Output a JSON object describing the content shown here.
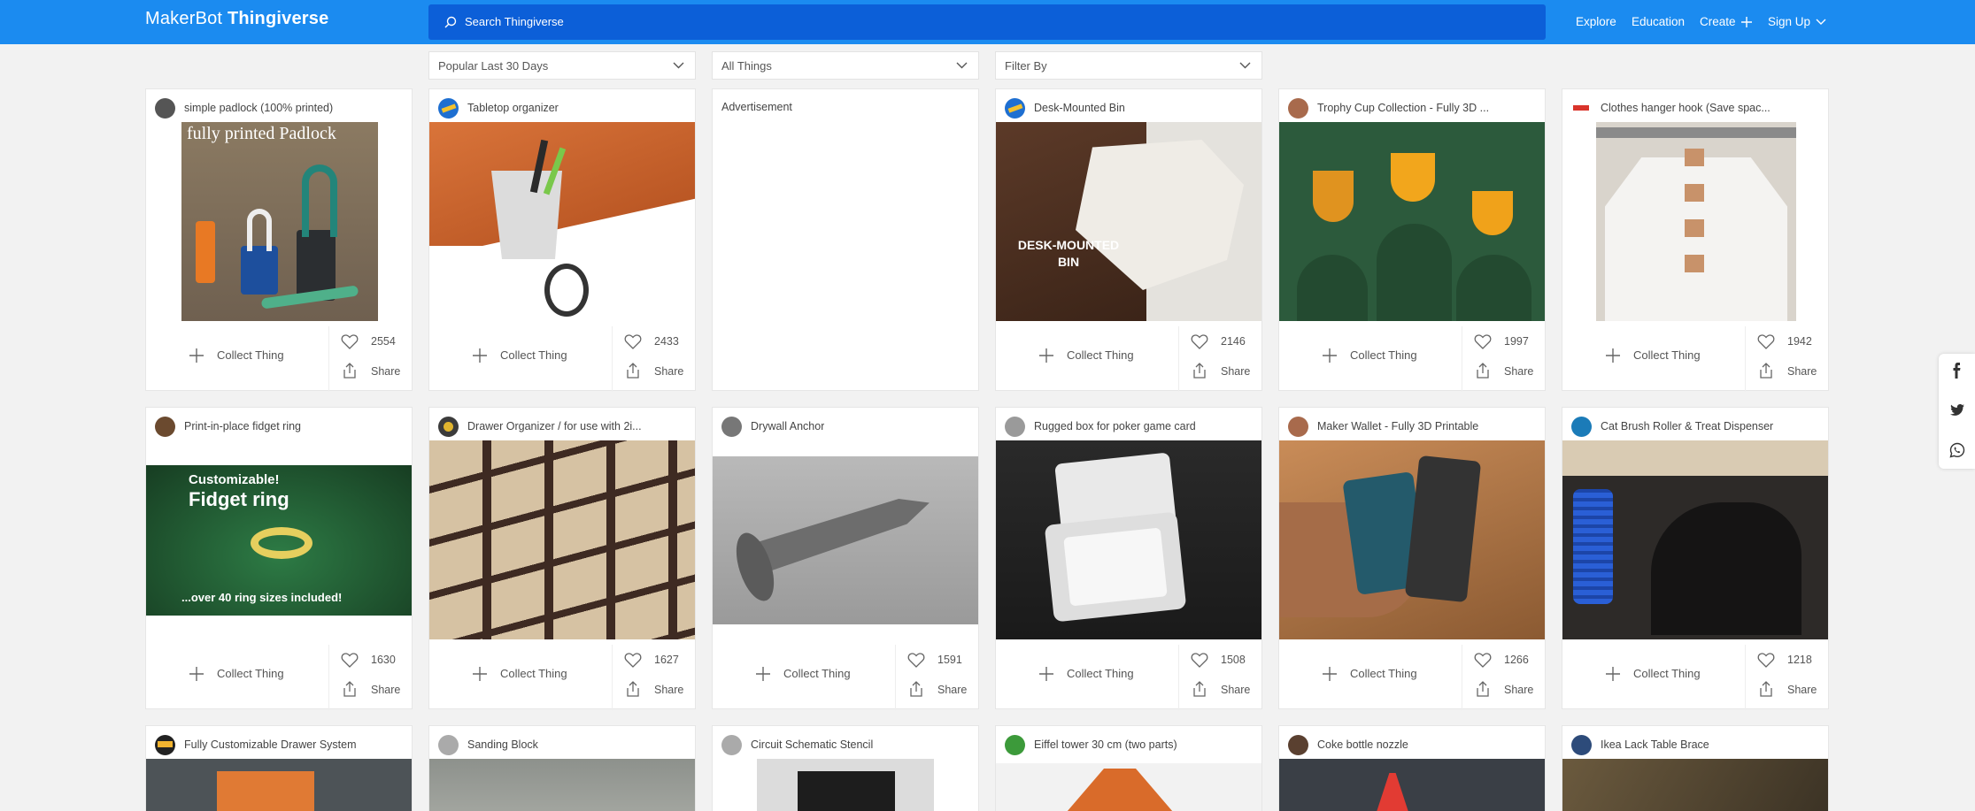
{
  "header": {
    "logo_brand": "MakerBot",
    "logo_product": "Thingiverse",
    "search_placeholder": "Search Thingiverse",
    "nav_explore": "Explore",
    "nav_education": "Education",
    "nav_create": "Create",
    "nav_signup": "Sign Up"
  },
  "filters": {
    "sort": "Popular Last 30 Days",
    "category": "All Things",
    "filter_by": "Filter By"
  },
  "ad_label": "Advertisement",
  "actions": {
    "collect_label": "Collect Thing",
    "share_label": "Share"
  },
  "cards_row1": [
    {
      "title": "simple padlock (100% printed)",
      "likes": "2554",
      "thumb_text": "fully printed Padlock"
    },
    {
      "title": "Tabletop organizer",
      "likes": "2433"
    },
    {
      "title": "Desk-Mounted Bin",
      "likes": "2146",
      "thumb_text": "DESK-MOUNTED BIN"
    },
    {
      "title": "Trophy Cup Collection - Fully 3D ...",
      "likes": "1997"
    },
    {
      "title": "Clothes hanger hook  (Save spac...",
      "likes": "1942"
    }
  ],
  "cards_row2": [
    {
      "title": "Print-in-place fidget ring",
      "likes": "1630",
      "thumb_text_1": "Customizable!",
      "thumb_text_2": "Fidget ring",
      "thumb_text_3": "...over 40 ring sizes included!"
    },
    {
      "title": "Drawer Organizer / for use with 2i...",
      "likes": "1627"
    },
    {
      "title": "Drywall Anchor",
      "likes": "1591"
    },
    {
      "title": "Rugged box for poker game card",
      "likes": "1508"
    },
    {
      "title": "Maker Wallet - Fully 3D Printable",
      "likes": "1266"
    },
    {
      "title": "Cat Brush Roller & Treat Dispenser",
      "likes": "1218"
    }
  ],
  "cards_row3": [
    {
      "title": "Fully Customizable Drawer System"
    },
    {
      "title": "Sanding Block"
    },
    {
      "title": "Circuit Schematic Stencil"
    },
    {
      "title": "Eiffel tower 30 cm (two parts)"
    },
    {
      "title": "Coke bottle nozzle"
    },
    {
      "title": "Ikea Lack Table Brace"
    }
  ],
  "colors": {
    "header_bg": "#1b8bf0",
    "search_bg": "#0c5fd8",
    "page_bg": "#f2f2f2"
  }
}
